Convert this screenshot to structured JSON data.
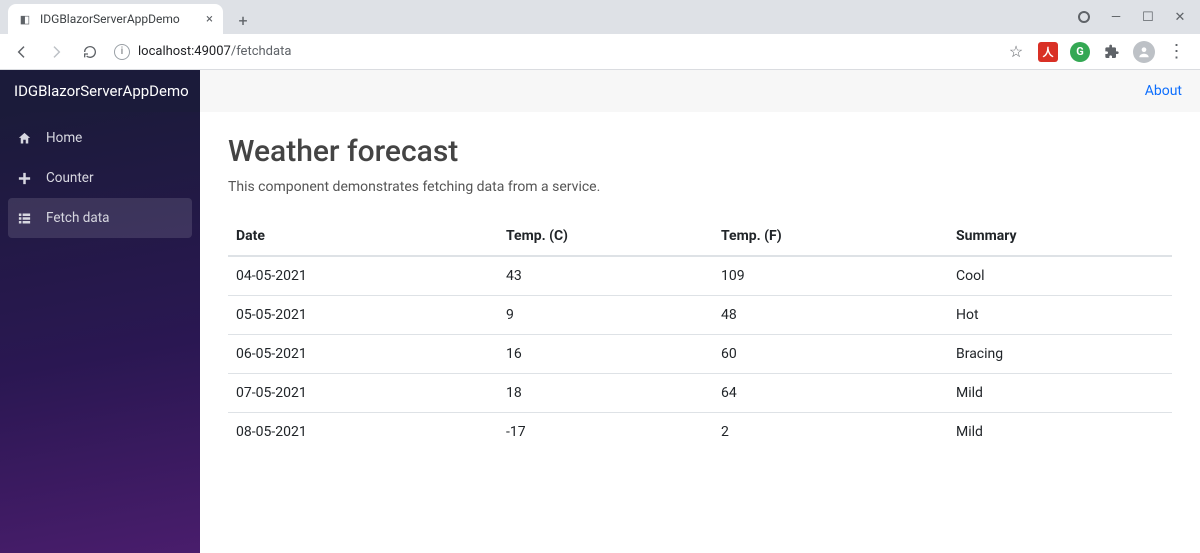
{
  "browser": {
    "tab_title": "IDGBlazorServerAppDemo",
    "url_host": "localhost:49007",
    "url_path": "/fetchdata"
  },
  "header": {
    "brand": "IDGBlazorServerAppDemo",
    "about_label": "About"
  },
  "sidebar": {
    "items": [
      {
        "label": "Home"
      },
      {
        "label": "Counter"
      },
      {
        "label": "Fetch data"
      }
    ]
  },
  "page": {
    "title": "Weather forecast",
    "lead": "This component demonstrates fetching data from a service."
  },
  "table": {
    "headers": {
      "date": "Date",
      "temp_c": "Temp. (C)",
      "temp_f": "Temp. (F)",
      "summary": "Summary"
    },
    "rows": [
      {
        "date": "04-05-2021",
        "temp_c": "43",
        "temp_f": "109",
        "summary": "Cool"
      },
      {
        "date": "05-05-2021",
        "temp_c": "9",
        "temp_f": "48",
        "summary": "Hot"
      },
      {
        "date": "06-05-2021",
        "temp_c": "16",
        "temp_f": "60",
        "summary": "Bracing"
      },
      {
        "date": "07-05-2021",
        "temp_c": "18",
        "temp_f": "64",
        "summary": "Mild"
      },
      {
        "date": "08-05-2021",
        "temp_c": "-17",
        "temp_f": "2",
        "summary": "Mild"
      }
    ]
  }
}
